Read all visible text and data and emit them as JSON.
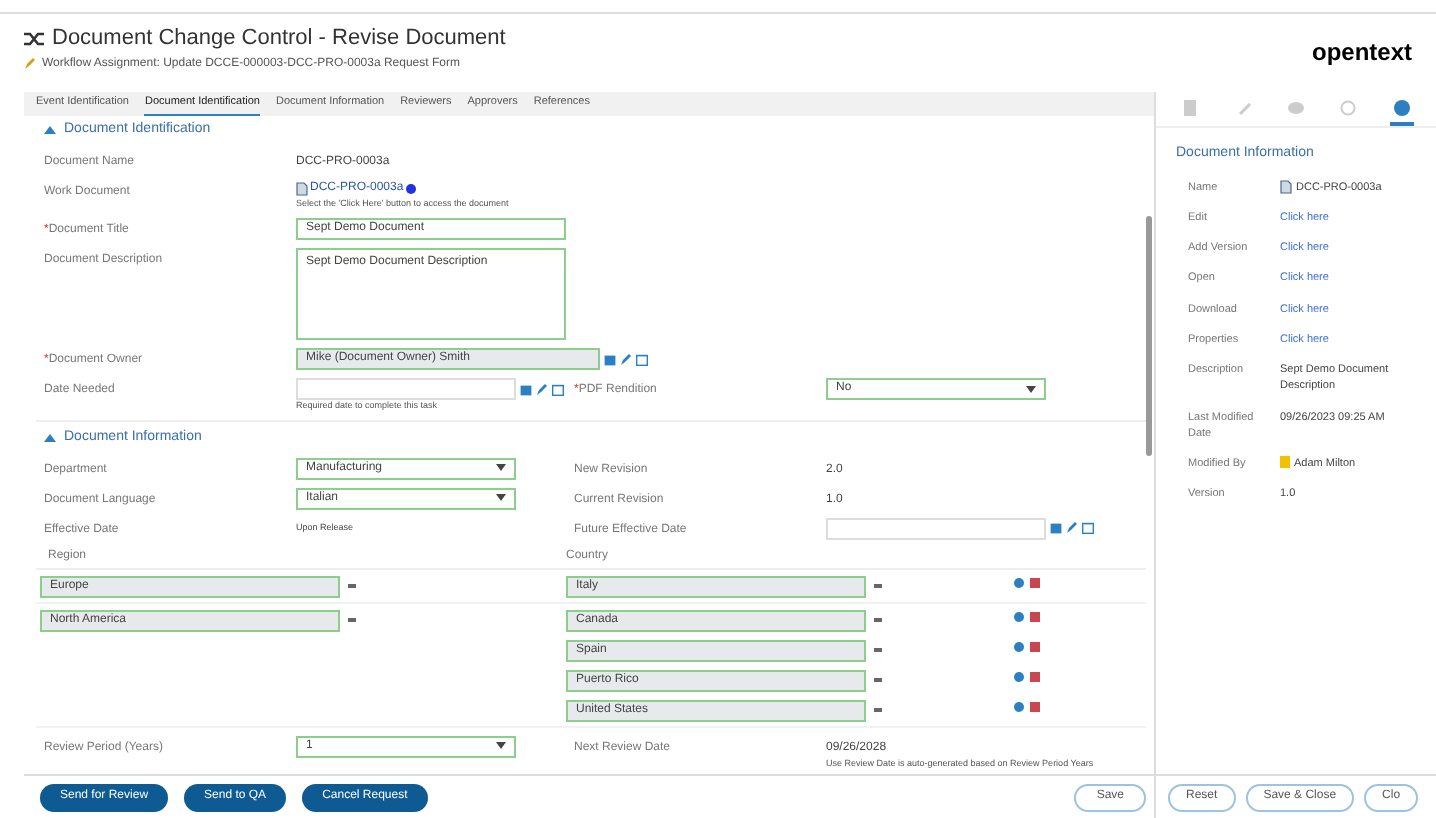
{
  "header": {
    "title": "Document Change Control - Revise Document",
    "subtitle": "Workflow Assignment: Update DCCE-000003-DCC-PRO-0003a Request Form"
  },
  "logo": "opentext",
  "tabs": [
    {
      "label": "Event Identification",
      "selected": false
    },
    {
      "label": "Document Identification",
      "selected": true
    },
    {
      "label": "Document Information",
      "selected": false
    },
    {
      "label": "Reviewers",
      "selected": false
    },
    {
      "label": "Approvers",
      "selected": false
    },
    {
      "label": "References",
      "selected": false
    }
  ],
  "sections": [
    {
      "title": "Document Identification",
      "expanded": true,
      "rows": [
        {
          "kind": "fields",
          "left": {
            "label": "Document Name",
            "kind": "text",
            "value": "DCC-PRO-0003a"
          }
        },
        {
          "kind": "fields",
          "left": {
            "label": "Work Document",
            "kind": "doc",
            "value": "DCC-PRO-0003a",
            "hint": "Select the 'Click Here' button to access the document"
          }
        },
        {
          "kind": "fields",
          "left": {
            "label": "Document Title",
            "required_mark": "*",
            "kind": "input",
            "value": "Sept Demo Document"
          }
        },
        {
          "kind": "fields",
          "left": {
            "label": "Document Description",
            "kind": "textarea",
            "value": "Sept Demo Document Description"
          }
        },
        {
          "kind": "fields",
          "left": {
            "label": "Document Owner",
            "required_mark": "*",
            "kind": "lookup",
            "value": "Mike (Document Owner) Smith"
          }
        },
        {
          "kind": "fields",
          "left": {
            "label": "Date Needed",
            "kind": "date",
            "hint": "Required date to complete this task"
          },
          "right": {
            "label": "PDF Rendition",
            "required_mark": "*",
            "kind": "select",
            "value": "No"
          }
        }
      ]
    },
    {
      "title": "Document Information",
      "expanded": true,
      "rows": [
        {
          "kind": "fields",
          "left": {
            "label": "Department",
            "kind": "select",
            "value": "Manufacturing"
          },
          "right": {
            "label": "New Revision",
            "kind": "text",
            "value": "2.0"
          }
        },
        {
          "kind": "fields",
          "left": {
            "label": "Document Language",
            "kind": "select",
            "value": "Italian"
          },
          "right": {
            "label": "Current Revision",
            "kind": "text",
            "value": "1.0"
          }
        },
        {
          "kind": "fields",
          "left": {
            "label": "Effective Date",
            "kind": "small",
            "value": "Upon Release"
          },
          "right": {
            "label": "Future Effective Date",
            "kind": "date"
          }
        },
        {
          "kind": "locations",
          "region_label": "Region",
          "country_label": "Country",
          "regions": [
            {
              "value": "Europe",
              "countries": [
                "Italy"
              ]
            },
            {
              "value": "North America",
              "countries": [
                "Canada",
                "Spain",
                "Puerto Rico",
                "United States"
              ]
            }
          ]
        },
        {
          "kind": "fields",
          "left": {
            "label": "Review Period (Years)",
            "kind": "select",
            "value": "1"
          },
          "right": {
            "label": "Next Review Date",
            "kind": "text",
            "value": "09/26/2028",
            "hint": "Use Review Date is auto-generated based on Review Period Years"
          }
        }
      ]
    }
  ],
  "panel_tabs": [
    {
      "selected": false
    },
    {
      "selected": false
    },
    {
      "selected": false
    },
    {
      "selected": false
    },
    {
      "selected": true
    }
  ],
  "info": {
    "title": "Document Information",
    "items": [
      {
        "label": "Name",
        "kind": "doc",
        "value": "DCC-PRO-0003a"
      },
      {
        "label": "Edit",
        "kind": "link",
        "value": "Click here"
      },
      {
        "label": "Add Version",
        "kind": "link",
        "value": "Click here"
      },
      {
        "label": "Open",
        "kind": "link",
        "value": "Click here"
      },
      {
        "label": "Download",
        "kind": "link",
        "value": "Click here"
      },
      {
        "label": "Properties",
        "kind": "link",
        "value": "Click here"
      },
      {
        "label": "Description",
        "kind": "text",
        "value": "Sept Demo Document Description"
      },
      {
        "label": "Last Modified Date",
        "kind": "text",
        "value": "09/26/2023 09:25 AM"
      },
      {
        "label": "Modified By",
        "kind": "user",
        "value": "Adam Milton"
      },
      {
        "label": "Version",
        "kind": "text",
        "value": "1.0"
      }
    ]
  },
  "left_buttons": [
    "Send for Review",
    "Send to QA",
    "Cancel Request"
  ],
  "right_buttons": [
    "Save",
    "Reset",
    "Save & Close",
    "Clo"
  ]
}
